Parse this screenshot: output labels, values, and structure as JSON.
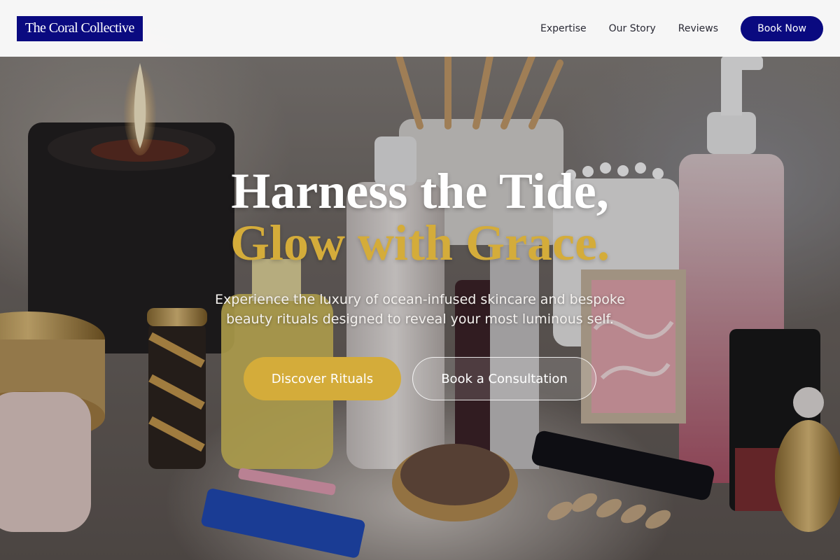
{
  "brand": {
    "name": "The Coral Collective"
  },
  "nav": {
    "links": [
      "Expertise",
      "Our Story",
      "Reviews"
    ],
    "cta": "Book Now"
  },
  "hero": {
    "headline_line1": "Harness the Tide,",
    "headline_line2": "Glow with Grace.",
    "subtext": "Experience the luxury of ocean-infused skincare and bespoke beauty rituals designed to reveal your most luminous self.",
    "primary_cta": "Discover Rituals",
    "secondary_cta": "Book a Consultation"
  },
  "colors": {
    "brand_navy": "#0a0a80",
    "accent_gold": "#d4ac3a",
    "nav_text": "#2a2a35"
  }
}
